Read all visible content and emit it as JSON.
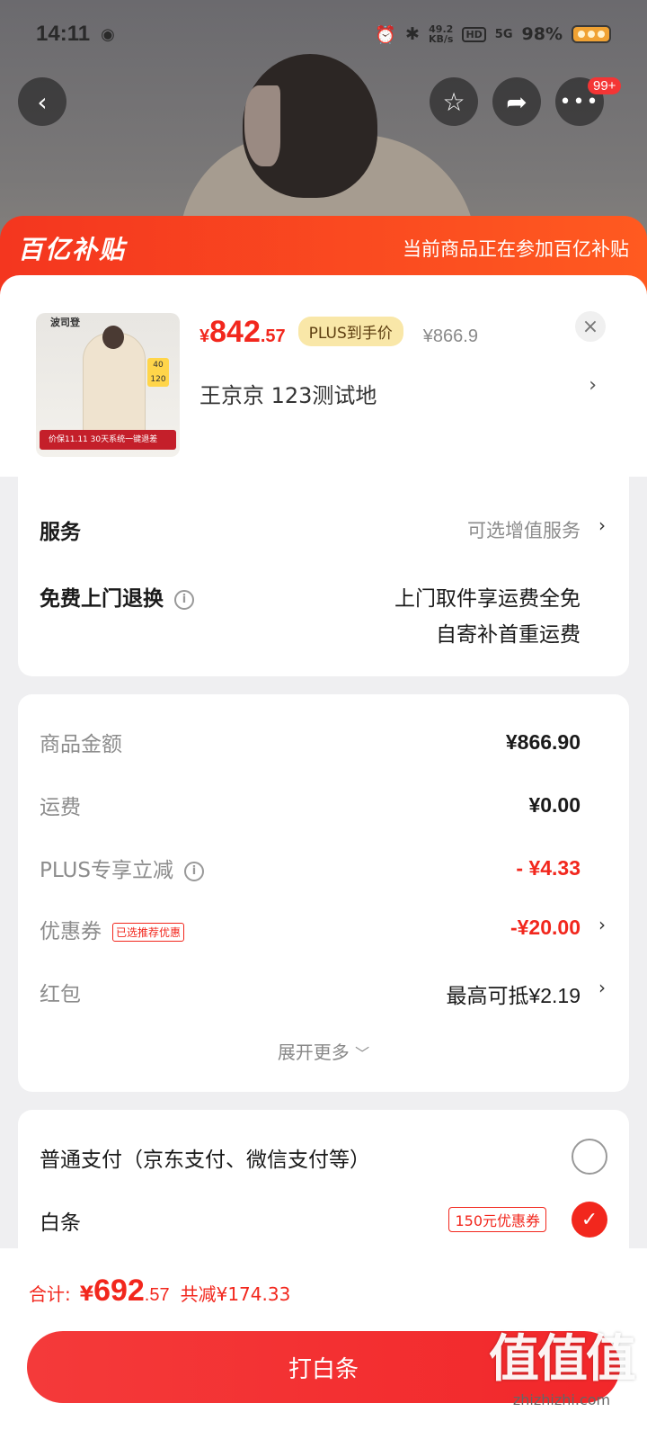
{
  "status_bar": {
    "time": "14:11",
    "net_speed_value": "49.2",
    "net_speed_unit": "KB/s",
    "hd": "HD",
    "signal": "5G",
    "battery": "98%"
  },
  "top_actions": {
    "more_badge": "99+"
  },
  "banner": {
    "logo": "百亿补贴",
    "notice": "当前商品正在参加百亿补贴"
  },
  "product": {
    "thumbnail_brand": "波司登",
    "thumbnail_strip": "价保11.11  30天系统一键退差",
    "thumbnail_tag_1": "40",
    "thumbnail_tag_2": "120",
    "price_currency": "¥",
    "price_int": "842",
    "price_dec": ".57",
    "plus_label": "PLUS到手价",
    "original_price": "¥866.9",
    "address": "王京京  123测试地"
  },
  "service": {
    "label": "服务",
    "value": "可选增值服务",
    "return_label": "免费上门退换",
    "return_line1": "上门取件享运费全免",
    "return_line2": "自寄补首重运费"
  },
  "summary": {
    "goods_label": "商品金额",
    "goods_value": "¥866.90",
    "shipping_label": "运费",
    "shipping_value": "¥0.00",
    "plus_label": "PLUS专享立减",
    "plus_value": "- ¥4.33",
    "coupon_label": "优惠券",
    "coupon_tag": "已选推荐优惠",
    "coupon_value": "-¥20.00",
    "redpacket_label": "红包",
    "redpacket_value": "最高可抵¥2.19",
    "expand": "展开更多"
  },
  "payment": {
    "option1": "普通支付（京东支付、微信支付等）",
    "option2": "白条",
    "option2_tag": "150元优惠券"
  },
  "footer": {
    "total_label": "合计:",
    "total_currency": "¥",
    "total_int": "692",
    "total_dec": ".57",
    "total_saving": "共减¥174.33",
    "pay_button": "打白条"
  },
  "watermark": {
    "big": "值值值",
    "small": "zhizhizhi.com"
  },
  "colors": {
    "accent_red": "#f2271d",
    "banner_orange": "#ff5a20",
    "plus_gold": "#f9e7a8"
  }
}
